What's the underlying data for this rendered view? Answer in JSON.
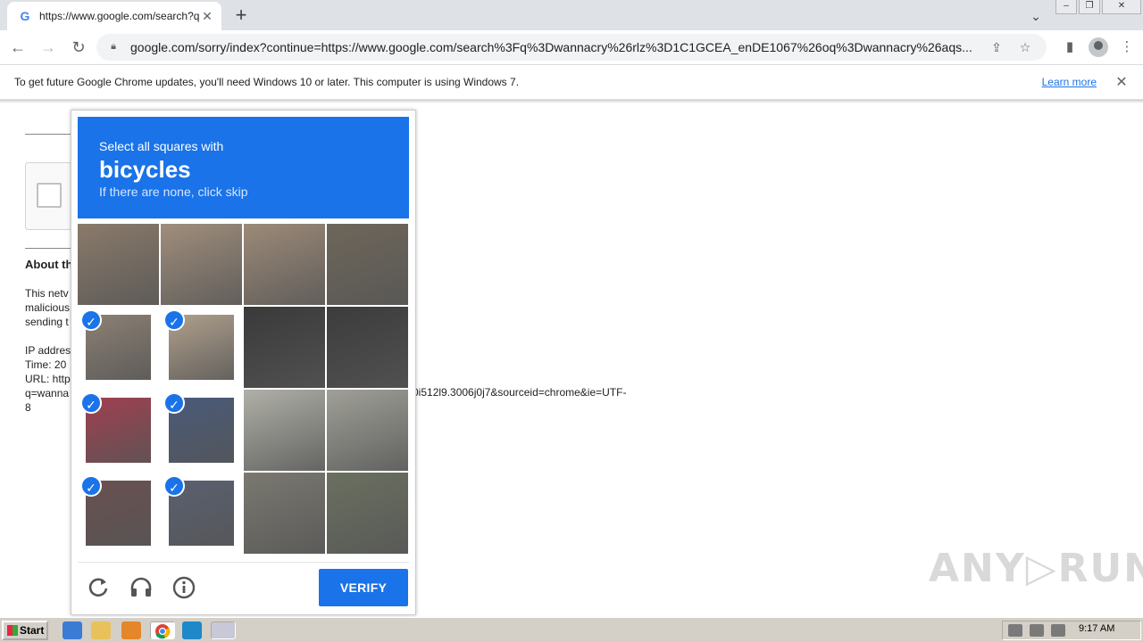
{
  "browser": {
    "tab_title": "https://www.google.com/search?q=",
    "tab_favicon": "G",
    "tab_close": "✕",
    "new_tab": "+",
    "url": "google.com/sorry/index?continue=https://www.google.com/search%3Fq%3Dwannacry%26rlz%3D1C1GCEA_enDE1067%26oq%3Dwannacry%26aqs...",
    "infobar_text": "To get future Google Chrome updates, you'll need Windows 10 or later. This computer is using Windows 7.",
    "infobar_link": "Learn more",
    "infobar_close": "✕"
  },
  "page": {
    "about_heading": "About th",
    "body_lines": [
      "This netv",
      "malicious",
      "sending t"
    ],
    "ip_lines": [
      "IP addres",
      "Time: 20",
      "URL: http",
      "q=wanna",
      "8"
    ],
    "url_tail": "0i512l9.3006j0j7&sourceid=chrome&ie=UTF-"
  },
  "captcha": {
    "line1": "Select all squares with",
    "object": "bicycles",
    "line3": "If there are none, click skip",
    "verify_label": "VERIFY",
    "selected_tiles": [
      4,
      5,
      8,
      9,
      12,
      13
    ],
    "tile_colors": [
      [
        "#8a7a6a",
        "#a08e7c",
        "#9c8a78",
        "#6e665a"
      ],
      [
        "#8c8074",
        "#b0a08c",
        "#3a3a3a",
        "#3c3c3c"
      ],
      [
        "#a04050",
        "#4a5a7a",
        "#b0b0a8",
        "#a0a098"
      ],
      [
        "#6a5050",
        "#5a6070",
        "#7a7870",
        "#6a7060"
      ]
    ]
  },
  "watermark": "ANY▷RUN",
  "taskbar": {
    "start_label": "Start",
    "clock": "9:17 AM"
  }
}
